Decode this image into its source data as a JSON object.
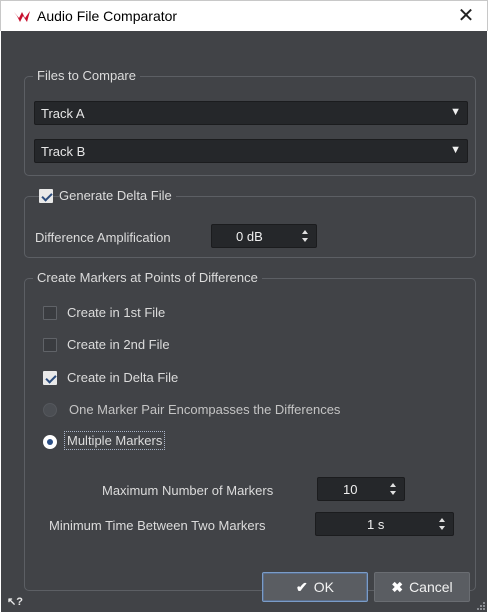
{
  "window": {
    "title": "Audio File Comparator",
    "close_glyph": "✕"
  },
  "files_group": {
    "title": "Files to Compare",
    "track_a": "Track A",
    "track_b": "Track B",
    "dropdown_arrow": "▼"
  },
  "delta_group": {
    "title": "Generate Delta File",
    "checked": true,
    "amplification_label": "Difference Amplification",
    "amplification_value": "0 dB"
  },
  "markers_group": {
    "title": "Create Markers at Points of Difference",
    "options": [
      {
        "label": "Create in 1st File",
        "checked": false
      },
      {
        "label": "Create in 2nd File",
        "checked": false
      },
      {
        "label": "Create in Delta File",
        "checked": true
      }
    ],
    "radios": [
      {
        "label": "One Marker Pair Encompasses the Differences",
        "selected": false
      },
      {
        "label": "Multiple Markers",
        "selected": true
      }
    ],
    "max_markers_label": "Maximum Number of Markers",
    "max_markers_value": "10",
    "min_time_label": "Minimum Time Between Two Markers",
    "min_time_value": "1 s"
  },
  "buttons": {
    "ok_label": "OK",
    "ok_icon": "✔",
    "cancel_label": "Cancel",
    "cancel_icon": "✖"
  },
  "footer": {
    "help_icon": "↖?"
  },
  "colors": {
    "dialog_bg": "#414347",
    "field_bg": "#25272a",
    "accent": "#2b4f86",
    "app_icon": "#c8102e"
  }
}
